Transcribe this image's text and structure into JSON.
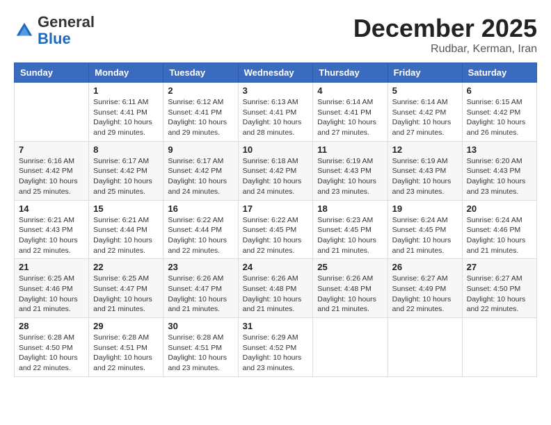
{
  "logo": {
    "general": "General",
    "blue": "Blue"
  },
  "header": {
    "month_title": "December 2025",
    "location": "Rudbar, Kerman, Iran"
  },
  "weekdays": [
    "Sunday",
    "Monday",
    "Tuesday",
    "Wednesday",
    "Thursday",
    "Friday",
    "Saturday"
  ],
  "weeks": [
    [
      {
        "day": "",
        "info": ""
      },
      {
        "day": "1",
        "info": "Sunrise: 6:11 AM\nSunset: 4:41 PM\nDaylight: 10 hours\nand 29 minutes."
      },
      {
        "day": "2",
        "info": "Sunrise: 6:12 AM\nSunset: 4:41 PM\nDaylight: 10 hours\nand 29 minutes."
      },
      {
        "day": "3",
        "info": "Sunrise: 6:13 AM\nSunset: 4:41 PM\nDaylight: 10 hours\nand 28 minutes."
      },
      {
        "day": "4",
        "info": "Sunrise: 6:14 AM\nSunset: 4:41 PM\nDaylight: 10 hours\nand 27 minutes."
      },
      {
        "day": "5",
        "info": "Sunrise: 6:14 AM\nSunset: 4:42 PM\nDaylight: 10 hours\nand 27 minutes."
      },
      {
        "day": "6",
        "info": "Sunrise: 6:15 AM\nSunset: 4:42 PM\nDaylight: 10 hours\nand 26 minutes."
      }
    ],
    [
      {
        "day": "7",
        "info": "Sunrise: 6:16 AM\nSunset: 4:42 PM\nDaylight: 10 hours\nand 25 minutes."
      },
      {
        "day": "8",
        "info": "Sunrise: 6:17 AM\nSunset: 4:42 PM\nDaylight: 10 hours\nand 25 minutes."
      },
      {
        "day": "9",
        "info": "Sunrise: 6:17 AM\nSunset: 4:42 PM\nDaylight: 10 hours\nand 24 minutes."
      },
      {
        "day": "10",
        "info": "Sunrise: 6:18 AM\nSunset: 4:42 PM\nDaylight: 10 hours\nand 24 minutes."
      },
      {
        "day": "11",
        "info": "Sunrise: 6:19 AM\nSunset: 4:43 PM\nDaylight: 10 hours\nand 23 minutes."
      },
      {
        "day": "12",
        "info": "Sunrise: 6:19 AM\nSunset: 4:43 PM\nDaylight: 10 hours\nand 23 minutes."
      },
      {
        "day": "13",
        "info": "Sunrise: 6:20 AM\nSunset: 4:43 PM\nDaylight: 10 hours\nand 23 minutes."
      }
    ],
    [
      {
        "day": "14",
        "info": "Sunrise: 6:21 AM\nSunset: 4:43 PM\nDaylight: 10 hours\nand 22 minutes."
      },
      {
        "day": "15",
        "info": "Sunrise: 6:21 AM\nSunset: 4:44 PM\nDaylight: 10 hours\nand 22 minutes."
      },
      {
        "day": "16",
        "info": "Sunrise: 6:22 AM\nSunset: 4:44 PM\nDaylight: 10 hours\nand 22 minutes."
      },
      {
        "day": "17",
        "info": "Sunrise: 6:22 AM\nSunset: 4:45 PM\nDaylight: 10 hours\nand 22 minutes."
      },
      {
        "day": "18",
        "info": "Sunrise: 6:23 AM\nSunset: 4:45 PM\nDaylight: 10 hours\nand 21 minutes."
      },
      {
        "day": "19",
        "info": "Sunrise: 6:24 AM\nSunset: 4:45 PM\nDaylight: 10 hours\nand 21 minutes."
      },
      {
        "day": "20",
        "info": "Sunrise: 6:24 AM\nSunset: 4:46 PM\nDaylight: 10 hours\nand 21 minutes."
      }
    ],
    [
      {
        "day": "21",
        "info": "Sunrise: 6:25 AM\nSunset: 4:46 PM\nDaylight: 10 hours\nand 21 minutes."
      },
      {
        "day": "22",
        "info": "Sunrise: 6:25 AM\nSunset: 4:47 PM\nDaylight: 10 hours\nand 21 minutes."
      },
      {
        "day": "23",
        "info": "Sunrise: 6:26 AM\nSunset: 4:47 PM\nDaylight: 10 hours\nand 21 minutes."
      },
      {
        "day": "24",
        "info": "Sunrise: 6:26 AM\nSunset: 4:48 PM\nDaylight: 10 hours\nand 21 minutes."
      },
      {
        "day": "25",
        "info": "Sunrise: 6:26 AM\nSunset: 4:48 PM\nDaylight: 10 hours\nand 21 minutes."
      },
      {
        "day": "26",
        "info": "Sunrise: 6:27 AM\nSunset: 4:49 PM\nDaylight: 10 hours\nand 22 minutes."
      },
      {
        "day": "27",
        "info": "Sunrise: 6:27 AM\nSunset: 4:50 PM\nDaylight: 10 hours\nand 22 minutes."
      }
    ],
    [
      {
        "day": "28",
        "info": "Sunrise: 6:28 AM\nSunset: 4:50 PM\nDaylight: 10 hours\nand 22 minutes."
      },
      {
        "day": "29",
        "info": "Sunrise: 6:28 AM\nSunset: 4:51 PM\nDaylight: 10 hours\nand 22 minutes."
      },
      {
        "day": "30",
        "info": "Sunrise: 6:28 AM\nSunset: 4:51 PM\nDaylight: 10 hours\nand 23 minutes."
      },
      {
        "day": "31",
        "info": "Sunrise: 6:29 AM\nSunset: 4:52 PM\nDaylight: 10 hours\nand 23 minutes."
      },
      {
        "day": "",
        "info": ""
      },
      {
        "day": "",
        "info": ""
      },
      {
        "day": "",
        "info": ""
      }
    ]
  ]
}
